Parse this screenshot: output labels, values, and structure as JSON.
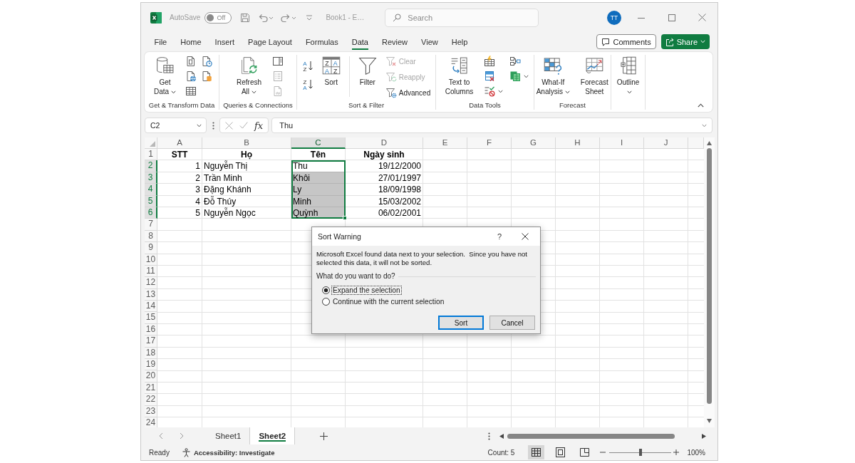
{
  "title_bar": {
    "autosave_label": "AutoSave",
    "autosave_toggle": {
      "on": false,
      "label": "Off"
    },
    "document_title": "Book1 - E…",
    "search": {
      "placeholder": "Search"
    },
    "user_initials": "TT"
  },
  "ribbon_tabs": [
    {
      "label": "File",
      "selected": false
    },
    {
      "label": "Home",
      "selected": false
    },
    {
      "label": "Insert",
      "selected": false
    },
    {
      "label": "Page Layout",
      "selected": false
    },
    {
      "label": "Formulas",
      "selected": false
    },
    {
      "label": "Data",
      "selected": true
    },
    {
      "label": "Review",
      "selected": false
    },
    {
      "label": "View",
      "selected": false
    },
    {
      "label": "Help",
      "selected": false
    }
  ],
  "comments_button": "Comments",
  "share_button": "Share",
  "ribbon_groups": [
    {
      "label": "Get & Transform Data",
      "items": [
        {
          "kind": "large",
          "label": "Get Data",
          "dropdown": true
        },
        {
          "kind": "icon_grid",
          "icons": [
            {
              "disabled": false,
              "dropdown": false
            },
            {
              "disabled": false,
              "dropdown": false
            },
            {
              "disabled": false,
              "dropdown": false
            },
            {
              "disabled": false,
              "dropdown": false
            },
            {
              "disabled": false,
              "dropdown": false
            }
          ]
        }
      ]
    },
    {
      "label": "Queries & Connections",
      "items": [
        {
          "kind": "large",
          "label": "Refresh All",
          "dropdown": true
        },
        {
          "kind": "icon_column",
          "icons": [
            {
              "disabled": false,
              "dropdown": false
            },
            {
              "disabled": true,
              "dropdown": false
            },
            {
              "disabled": true,
              "dropdown": false
            }
          ]
        }
      ]
    },
    {
      "label": "Sort & Filter",
      "items": [
        {
          "kind": "sort_pair",
          "glyphs": [
            [
              "A",
              "Z"
            ],
            [
              "Z",
              "A"
            ]
          ]
        },
        {
          "kind": "large",
          "label": "Sort",
          "dropdown": false,
          "glyphs": [
            "Z",
            "A",
            "A",
            "Z"
          ]
        },
        {
          "kind": "large",
          "label": "Filter",
          "dropdown": false
        },
        {
          "kind": "small_list",
          "buttons": [
            {
              "label": "Clear",
              "disabled": true
            },
            {
              "label": "Reapply",
              "disabled": true
            },
            {
              "label": "Advanced",
              "disabled": false
            }
          ]
        }
      ]
    },
    {
      "label": "Data Tools",
      "items": [
        {
          "kind": "large",
          "label": "Text to Columns",
          "dropdown": false
        },
        {
          "kind": "icon_column",
          "icons": [
            {
              "disabled": false,
              "dropdown": false
            },
            {
              "disabled": false,
              "dropdown": false
            },
            {
              "disabled": false,
              "dropdown": true
            }
          ]
        },
        {
          "kind": "icon_column",
          "icons": [
            {
              "disabled": false,
              "dropdown": false
            },
            {
              "disabled": false,
              "dropdown": true
            }
          ]
        }
      ]
    },
    {
      "label": "Forecast",
      "items": [
        {
          "kind": "large",
          "label": "What-If Analysis",
          "dropdown": true
        },
        {
          "kind": "large",
          "label": "Forecast Sheet",
          "dropdown": false
        }
      ]
    },
    {
      "items": [
        {
          "kind": "large",
          "label": "Outline",
          "dropdown": true
        }
      ]
    }
  ],
  "formula_bar": {
    "name_box": "C2",
    "function_label": "fx",
    "formula": "Thu"
  },
  "sheet": {
    "columns": [
      {
        "label": "A",
        "selected": false
      },
      {
        "label": "B",
        "selected": false
      },
      {
        "label": "C",
        "selected": true
      },
      {
        "label": "D",
        "selected": false
      },
      {
        "label": "E",
        "selected": false
      },
      {
        "label": "F",
        "selected": false
      },
      {
        "label": "G",
        "selected": false
      },
      {
        "label": "H",
        "selected": false
      },
      {
        "label": "I",
        "selected": false
      },
      {
        "label": "J",
        "selected": false
      }
    ],
    "rows": [
      {
        "label": "1",
        "selected": false,
        "cells": [
          {
            "text": "STT",
            "kind": "heading",
            "selected": false,
            "active": false
          },
          {
            "text": "Họ",
            "kind": "heading",
            "selected": false,
            "active": false
          },
          {
            "text": "Tên",
            "kind": "heading",
            "selected": false,
            "active": false
          },
          {
            "text": "Ngày sinh",
            "kind": "heading",
            "selected": false,
            "active": false
          }
        ]
      },
      {
        "label": "2",
        "selected": true,
        "cells": [
          {
            "text": "1",
            "kind": "number",
            "selected": false,
            "active": false
          },
          {
            "text": "Nguyễn Thị",
            "kind": "text",
            "selected": false,
            "active": false
          },
          {
            "text": "Thu",
            "kind": "text",
            "selected": true,
            "active": true
          },
          {
            "text": "19/12/2000",
            "kind": "date",
            "selected": false,
            "active": false
          }
        ]
      },
      {
        "label": "3",
        "selected": true,
        "cells": [
          {
            "text": "2",
            "kind": "number",
            "selected": false,
            "active": false
          },
          {
            "text": "Trần Minh",
            "kind": "text",
            "selected": false,
            "active": false
          },
          {
            "text": "Khôi",
            "kind": "text",
            "selected": true,
            "active": false
          },
          {
            "text": "27/01/1997",
            "kind": "date",
            "selected": false,
            "active": false
          }
        ]
      },
      {
        "label": "4",
        "selected": true,
        "cells": [
          {
            "text": "3",
            "kind": "number",
            "selected": false,
            "active": false
          },
          {
            "text": "Đặng Khánh",
            "kind": "text",
            "selected": false,
            "active": false
          },
          {
            "text": "Ly",
            "kind": "text",
            "selected": true,
            "active": false
          },
          {
            "text": "18/09/1998",
            "kind": "date",
            "selected": false,
            "active": false
          }
        ]
      },
      {
        "label": "5",
        "selected": true,
        "cells": [
          {
            "text": "4",
            "kind": "number",
            "selected": false,
            "active": false
          },
          {
            "text": "Đỗ Thúy",
            "kind": "text",
            "selected": false,
            "active": false
          },
          {
            "text": "Minh",
            "kind": "text",
            "selected": true,
            "active": false
          },
          {
            "text": "15/03/2002",
            "kind": "date",
            "selected": false,
            "active": false
          }
        ]
      },
      {
        "label": "6",
        "selected": true,
        "cells": [
          {
            "text": "5",
            "kind": "number",
            "selected": false,
            "active": false
          },
          {
            "text": "Nguyễn Ngọc",
            "kind": "text",
            "selected": false,
            "active": false
          },
          {
            "text": "Quỳnh",
            "kind": "text",
            "selected": true,
            "active": false
          },
          {
            "text": "06/02/2001",
            "kind": "date",
            "selected": false,
            "active": false
          }
        ]
      },
      {
        "label": "7",
        "selected": false
      },
      {
        "label": "8",
        "selected": false
      },
      {
        "label": "9",
        "selected": false
      },
      {
        "label": "10",
        "selected": false
      },
      {
        "label": "11",
        "selected": false
      },
      {
        "label": "12",
        "selected": false
      },
      {
        "label": "13",
        "selected": false
      },
      {
        "label": "14",
        "selected": false
      },
      {
        "label": "15",
        "selected": false
      },
      {
        "label": "16",
        "selected": false
      },
      {
        "label": "17",
        "selected": false
      },
      {
        "label": "18",
        "selected": false
      },
      {
        "label": "19",
        "selected": false
      },
      {
        "label": "20",
        "selected": false
      },
      {
        "label": "21",
        "selected": false
      },
      {
        "label": "22",
        "selected": false
      },
      {
        "label": "23",
        "selected": false
      },
      {
        "label": "24",
        "selected": false
      }
    ]
  },
  "dialog": {
    "title": "Sort Warning",
    "help_label": "?",
    "message": "Microsoft Excel found data next to your selection.  Since you have not selected this data, it will not be sorted.",
    "question": "What do you want to do?",
    "options": [
      {
        "label": "Expand the selection",
        "selected": true,
        "focused": true
      },
      {
        "label": "Continue with the current selection",
        "selected": false,
        "focused": false
      }
    ],
    "buttons": [
      {
        "label": "Sort",
        "default": true
      },
      {
        "label": "Cancel",
        "default": false
      }
    ]
  },
  "sheet_tabs": [
    {
      "label": "Sheet1",
      "selected": false
    },
    {
      "label": "Sheet2",
      "selected": true
    }
  ],
  "status_bar": {
    "mode": "Ready",
    "accessibility": "Accessibility: Investigate",
    "summary": "Count: 5",
    "views": [
      {
        "selected": true
      },
      {
        "selected": false
      },
      {
        "selected": false
      }
    ],
    "zoom": {
      "level": 0.5,
      "reading": "100%"
    }
  }
}
